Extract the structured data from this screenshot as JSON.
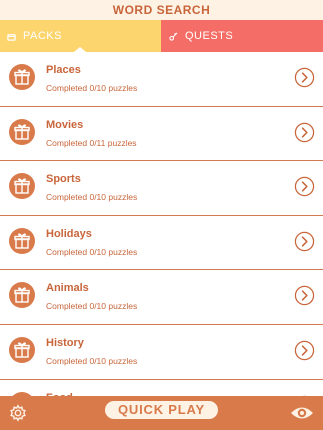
{
  "header": {
    "title": "WORD SEARCH"
  },
  "tabs": [
    {
      "label": "PACKS",
      "icon": "pack-icon",
      "active": true
    },
    {
      "label": "QUESTS",
      "icon": "quest-icon",
      "active": false
    }
  ],
  "packs": [
    {
      "name": "Places",
      "progress": "Completed 0/10 puzzles",
      "icon": "gift-icon"
    },
    {
      "name": "Movies",
      "progress": "Completed 0/11 puzzles",
      "icon": "gift-icon"
    },
    {
      "name": "Sports",
      "progress": "Completed 0/10 puzzles",
      "icon": "gift-icon"
    },
    {
      "name": "Holidays",
      "progress": "Completed 0/10 puzzles",
      "icon": "gift-icon"
    },
    {
      "name": "Animals",
      "progress": "Completed 0/10 puzzles",
      "icon": "gift-icon"
    },
    {
      "name": "History",
      "progress": "Completed 0/10 puzzles",
      "icon": "gift-icon"
    },
    {
      "name": "Food",
      "progress": "",
      "icon": "gift-icon"
    }
  ],
  "bottom_bar": {
    "quick_play_label": "QUICK PLAY",
    "settings_icon": "gear-icon",
    "view_icon": "eye-icon"
  },
  "colors": {
    "accent": "#c8653a",
    "tab_packs": "#fdd56e",
    "tab_quests": "#f46d66",
    "bottom_bar": "#d97a4a",
    "header_bg": "#fdf2e4"
  }
}
